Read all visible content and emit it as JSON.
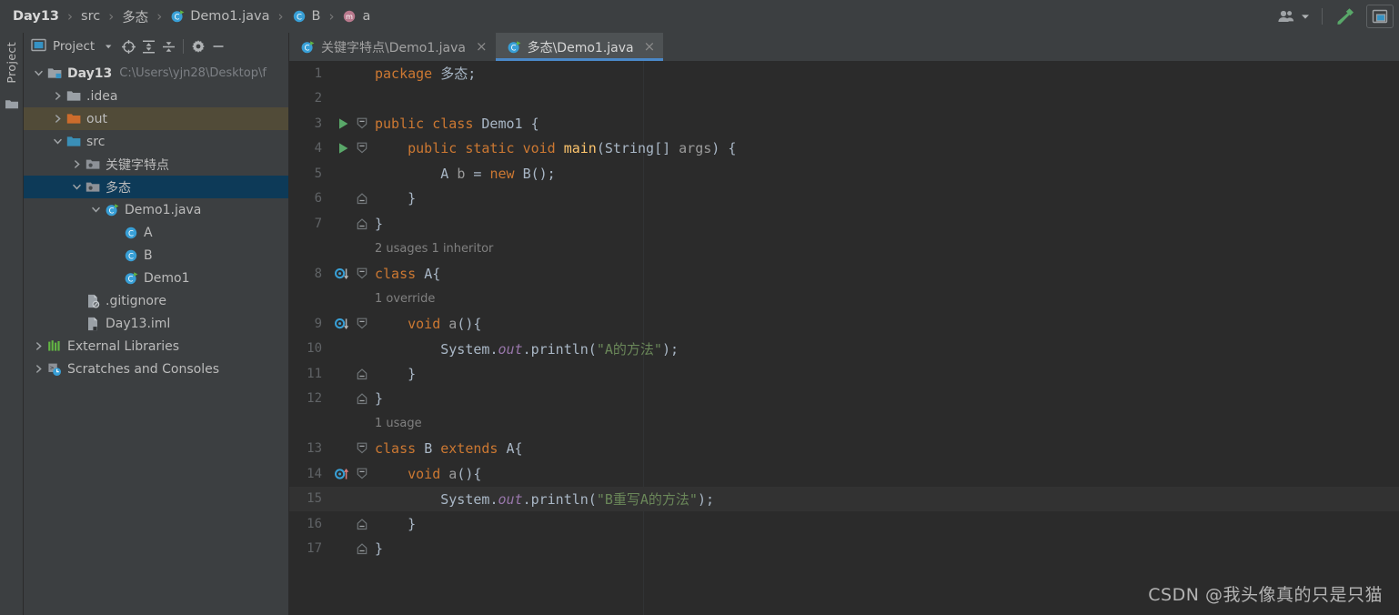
{
  "breadcrumb": {
    "separator": "›",
    "items": [
      {
        "label": "Day13",
        "icon": "none"
      },
      {
        "label": "src",
        "icon": "none"
      },
      {
        "label": "多态",
        "icon": "none"
      },
      {
        "label": "Demo1.java",
        "icon": "java-class-run-icon"
      },
      {
        "label": "B",
        "icon": "class-icon"
      },
      {
        "label": "a",
        "icon": "method-icon"
      }
    ]
  },
  "topbar_right": {
    "users_icon": "users-icon",
    "dropdown_icon": "chevron-down-icon",
    "build_icon": "hammer-build-icon",
    "layout_icon": "window-layout-icon"
  },
  "toolstrip": {
    "tab_label": "Project",
    "folder_icon": "folder-icon"
  },
  "project_panel": {
    "title": "Project",
    "buttons": [
      {
        "name": "project-view-dropdown",
        "icon": "chevron-down-small-icon"
      },
      {
        "name": "scroll-from-source",
        "icon": "locate-target-icon"
      },
      {
        "name": "expand-all",
        "icon": "expand-all-icon"
      },
      {
        "name": "collapse-all",
        "icon": "collapse-all-icon"
      },
      {
        "name": "project-settings",
        "icon": "gear-icon"
      },
      {
        "name": "hide-panel",
        "icon": "minus-icon"
      }
    ],
    "tree": [
      {
        "label": "Day13",
        "path": "C:\\Users\\yjn28\\Desktop\\f",
        "indent": 0,
        "arrow": "down",
        "icon": "module-folder-icon",
        "bold": true,
        "state": "normal"
      },
      {
        "label": ".idea",
        "path": "",
        "indent": 1,
        "arrow": "right",
        "icon": "folder-icon",
        "bold": false,
        "state": "normal"
      },
      {
        "label": "out",
        "path": "",
        "indent": 1,
        "arrow": "right",
        "icon": "folder-orange-icon",
        "bold": false,
        "state": "excluded"
      },
      {
        "label": "src",
        "path": "",
        "indent": 1,
        "arrow": "down",
        "icon": "folder-source-icon",
        "bold": false,
        "state": "normal"
      },
      {
        "label": "关键字特点",
        "path": "",
        "indent": 2,
        "arrow": "right",
        "icon": "package-icon",
        "bold": false,
        "state": "normal"
      },
      {
        "label": "多态",
        "path": "",
        "indent": 2,
        "arrow": "down",
        "icon": "package-icon",
        "bold": false,
        "state": "selected"
      },
      {
        "label": "Demo1.java",
        "path": "",
        "indent": 3,
        "arrow": "down",
        "icon": "java-class-run-icon",
        "bold": false,
        "state": "normal"
      },
      {
        "label": "A",
        "path": "",
        "indent": 4,
        "arrow": "none",
        "icon": "class-icon",
        "bold": false,
        "state": "normal"
      },
      {
        "label": "B",
        "path": "",
        "indent": 4,
        "arrow": "none",
        "icon": "class-icon",
        "bold": false,
        "state": "normal"
      },
      {
        "label": "Demo1",
        "path": "",
        "indent": 4,
        "arrow": "none",
        "icon": "java-class-run-icon",
        "bold": false,
        "state": "normal"
      },
      {
        "label": ".gitignore",
        "path": "",
        "indent": 2,
        "arrow": "none",
        "icon": "gitignore-file-icon",
        "bold": false,
        "state": "normal"
      },
      {
        "label": "Day13.iml",
        "path": "",
        "indent": 2,
        "arrow": "none",
        "icon": "iml-file-icon",
        "bold": false,
        "state": "normal"
      },
      {
        "label": "External Libraries",
        "path": "",
        "indent": 0,
        "arrow": "right",
        "icon": "libraries-icon",
        "bold": false,
        "state": "normal"
      },
      {
        "label": "Scratches and Consoles",
        "path": "",
        "indent": 0,
        "arrow": "right",
        "icon": "scratches-icon",
        "bold": false,
        "state": "normal"
      }
    ]
  },
  "editor_tabs": [
    {
      "label": "关键字特点\\Demo1.java",
      "icon": "java-class-run-icon",
      "close": "×",
      "active": false
    },
    {
      "label": "多态\\Demo1.java",
      "icon": "java-class-run-icon",
      "close": "×",
      "active": true
    }
  ],
  "code": {
    "language": "java",
    "caret_line": 15,
    "lines": [
      {
        "num": "1",
        "gutter": "none",
        "fold": "none",
        "caret": false,
        "tokens": [
          {
            "t": "package ",
            "c": "kw"
          },
          {
            "t": "多态",
            "c": "ident"
          },
          {
            "t": ";",
            "c": "punc"
          }
        ]
      },
      {
        "num": "2",
        "gutter": "none",
        "fold": "none",
        "caret": false,
        "tokens": []
      },
      {
        "num": "3",
        "gutter": "run",
        "fold": "open",
        "caret": false,
        "tokens": [
          {
            "t": "public ",
            "c": "kw"
          },
          {
            "t": "class ",
            "c": "kw"
          },
          {
            "t": "Demo1 ",
            "c": "cls"
          },
          {
            "t": "{",
            "c": "punc"
          }
        ]
      },
      {
        "num": "4",
        "gutter": "run",
        "fold": "open",
        "caret": false,
        "tokens": [
          {
            "t": "    ",
            "c": "punc"
          },
          {
            "t": "public ",
            "c": "kw"
          },
          {
            "t": "static ",
            "c": "kw"
          },
          {
            "t": "void ",
            "c": "kw"
          },
          {
            "t": "main",
            "c": "meth"
          },
          {
            "t": "(",
            "c": "punc"
          },
          {
            "t": "String",
            "c": "cls"
          },
          {
            "t": "[] ",
            "c": "punc"
          },
          {
            "t": "args",
            "c": "var"
          },
          {
            "t": ") {",
            "c": "punc"
          }
        ]
      },
      {
        "num": "5",
        "gutter": "none",
        "fold": "pipe",
        "caret": false,
        "tokens": [
          {
            "t": "        ",
            "c": "punc"
          },
          {
            "t": "A ",
            "c": "cls"
          },
          {
            "t": "b ",
            "c": "var"
          },
          {
            "t": "= ",
            "c": "punc"
          },
          {
            "t": "new ",
            "c": "kw"
          },
          {
            "t": "B",
            "c": "cls"
          },
          {
            "t": "();",
            "c": "punc"
          }
        ]
      },
      {
        "num": "6",
        "gutter": "none",
        "fold": "close",
        "caret": false,
        "tokens": [
          {
            "t": "    }",
            "c": "punc"
          }
        ]
      },
      {
        "num": "7",
        "gutter": "none",
        "fold": "close",
        "caret": false,
        "tokens": [
          {
            "t": "}",
            "c": "punc"
          }
        ]
      },
      {
        "num": "",
        "gutter": "none",
        "fold": "none",
        "caret": false,
        "inlay": "2 usages   1 inheritor",
        "tokens": []
      },
      {
        "num": "8",
        "gutter": "overridden",
        "fold": "open",
        "caret": false,
        "tokens": [
          {
            "t": "class ",
            "c": "kw"
          },
          {
            "t": "A",
            "c": "cls"
          },
          {
            "t": "{",
            "c": "punc"
          }
        ]
      },
      {
        "num": "",
        "gutter": "none",
        "fold": "pipe",
        "caret": false,
        "inlay": "1 override",
        "tokens": []
      },
      {
        "num": "9",
        "gutter": "overridden",
        "fold": "open",
        "caret": false,
        "tokens": [
          {
            "t": "    ",
            "c": "punc"
          },
          {
            "t": "void ",
            "c": "kw"
          },
          {
            "t": "a",
            "c": "var"
          },
          {
            "t": "(){",
            "c": "punc"
          }
        ]
      },
      {
        "num": "10",
        "gutter": "none",
        "fold": "pipe",
        "caret": false,
        "tokens": [
          {
            "t": "        ",
            "c": "punc"
          },
          {
            "t": "System",
            "c": "cls"
          },
          {
            "t": ".",
            "c": "punc"
          },
          {
            "t": "out",
            "c": "fld"
          },
          {
            "t": ".println(",
            "c": "punc"
          },
          {
            "t": "\"A的方法\"",
            "c": "str"
          },
          {
            "t": ");",
            "c": "punc"
          }
        ]
      },
      {
        "num": "11",
        "gutter": "none",
        "fold": "close",
        "caret": false,
        "tokens": [
          {
            "t": "    }",
            "c": "punc"
          }
        ]
      },
      {
        "num": "12",
        "gutter": "none",
        "fold": "close",
        "caret": false,
        "tokens": [
          {
            "t": "}",
            "c": "punc"
          }
        ]
      },
      {
        "num": "",
        "gutter": "none",
        "fold": "none",
        "caret": false,
        "inlay": "1 usage",
        "tokens": []
      },
      {
        "num": "13",
        "gutter": "none",
        "fold": "open",
        "caret": false,
        "tokens": [
          {
            "t": "class ",
            "c": "kw"
          },
          {
            "t": "B ",
            "c": "cls"
          },
          {
            "t": "extends ",
            "c": "kw"
          },
          {
            "t": "A",
            "c": "cls"
          },
          {
            "t": "{",
            "c": "punc"
          }
        ]
      },
      {
        "num": "14",
        "gutter": "overriding",
        "fold": "open",
        "caret": false,
        "tokens": [
          {
            "t": "    ",
            "c": "punc"
          },
          {
            "t": "void ",
            "c": "kw"
          },
          {
            "t": "a",
            "c": "var"
          },
          {
            "t": "(){",
            "c": "punc"
          }
        ]
      },
      {
        "num": "15",
        "gutter": "none",
        "fold": "pipe",
        "caret": true,
        "tokens": [
          {
            "t": "        ",
            "c": "punc"
          },
          {
            "t": "System",
            "c": "cls"
          },
          {
            "t": ".",
            "c": "punc"
          },
          {
            "t": "out",
            "c": "fld"
          },
          {
            "t": ".println(",
            "c": "punc"
          },
          {
            "t": "\"B重写A的方法\"",
            "c": "str"
          },
          {
            "t": ");",
            "c": "punc"
          }
        ]
      },
      {
        "num": "16",
        "gutter": "none",
        "fold": "close",
        "caret": false,
        "tokens": [
          {
            "t": "    }",
            "c": "punc"
          }
        ]
      },
      {
        "num": "17",
        "gutter": "none",
        "fold": "close",
        "caret": false,
        "tokens": [
          {
            "t": "}",
            "c": "punc"
          }
        ]
      }
    ]
  },
  "watermark": "CSDN @我头像真的只是只猫",
  "colors": {
    "panel_bg": "#3c3f41",
    "editor_bg": "#2b2b2b",
    "caret_line_bg": "#323232",
    "selection_bg": "#0d3a58",
    "excluded_bg": "#514b38",
    "tab_active_bg": "#4e5254",
    "tab_underline": "#4a88c7",
    "keyword": "#cc7832",
    "string": "#6a8759",
    "field": "#9876aa",
    "method": "#ffc66d",
    "text": "#a9b7c6",
    "linenum": "#606366",
    "inlay": "#808080"
  }
}
